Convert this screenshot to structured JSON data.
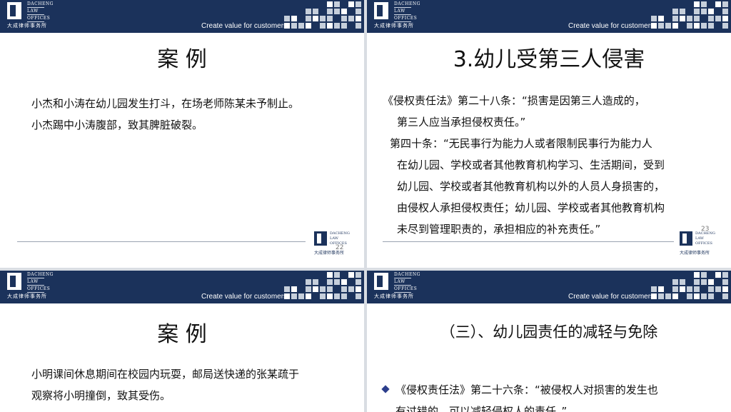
{
  "brand": {
    "logo_en": [
      "DACHENG",
      "LAW",
      "OFFICES"
    ],
    "logo_cn": "大成律师事务所",
    "tagline": "Create value for customers",
    "banner_color": "#1b325b"
  },
  "slides": [
    {
      "title": "案  例",
      "lines": [
        "小杰和小涛在幼儿园发生打斗，在场老师陈某未予制止。",
        "小杰踢中小涛腹部，致其脾脏破裂。"
      ],
      "page": "22"
    },
    {
      "title": "3.幼儿受第三人侵害",
      "lines": [
        "《侵权责任法》第二十八条：“损害是因第三人造成的，",
        "第三人应当承担侵权责任。”",
        "第四十条：“无民事行为能力人或者限制民事行为能力人",
        "在幼儿园、学校或者其他教育机构学习、生活期间，受到",
        "幼儿园、学校或者其他教育机构以外的人员人身损害的，",
        "由侵权人承担侵权责任；幼儿园、学校或者其他教育机构",
        "未尽到管理职责的，承担相应的补充责任。”"
      ],
      "page": "23"
    },
    {
      "title": "案  例",
      "lines": [
        "小明课间休息期间在校园内玩耍，邮局送快递的张某疏于",
        "观察将小明撞倒，致其受伤。"
      ]
    },
    {
      "title": "（三）、幼儿园责任的减轻与免除",
      "lines": [
        "《侵权责任法》第二十六条：“被侵权人对损害的发生也",
        "有过错的，可以减轻侵权人的责任。”"
      ]
    }
  ]
}
